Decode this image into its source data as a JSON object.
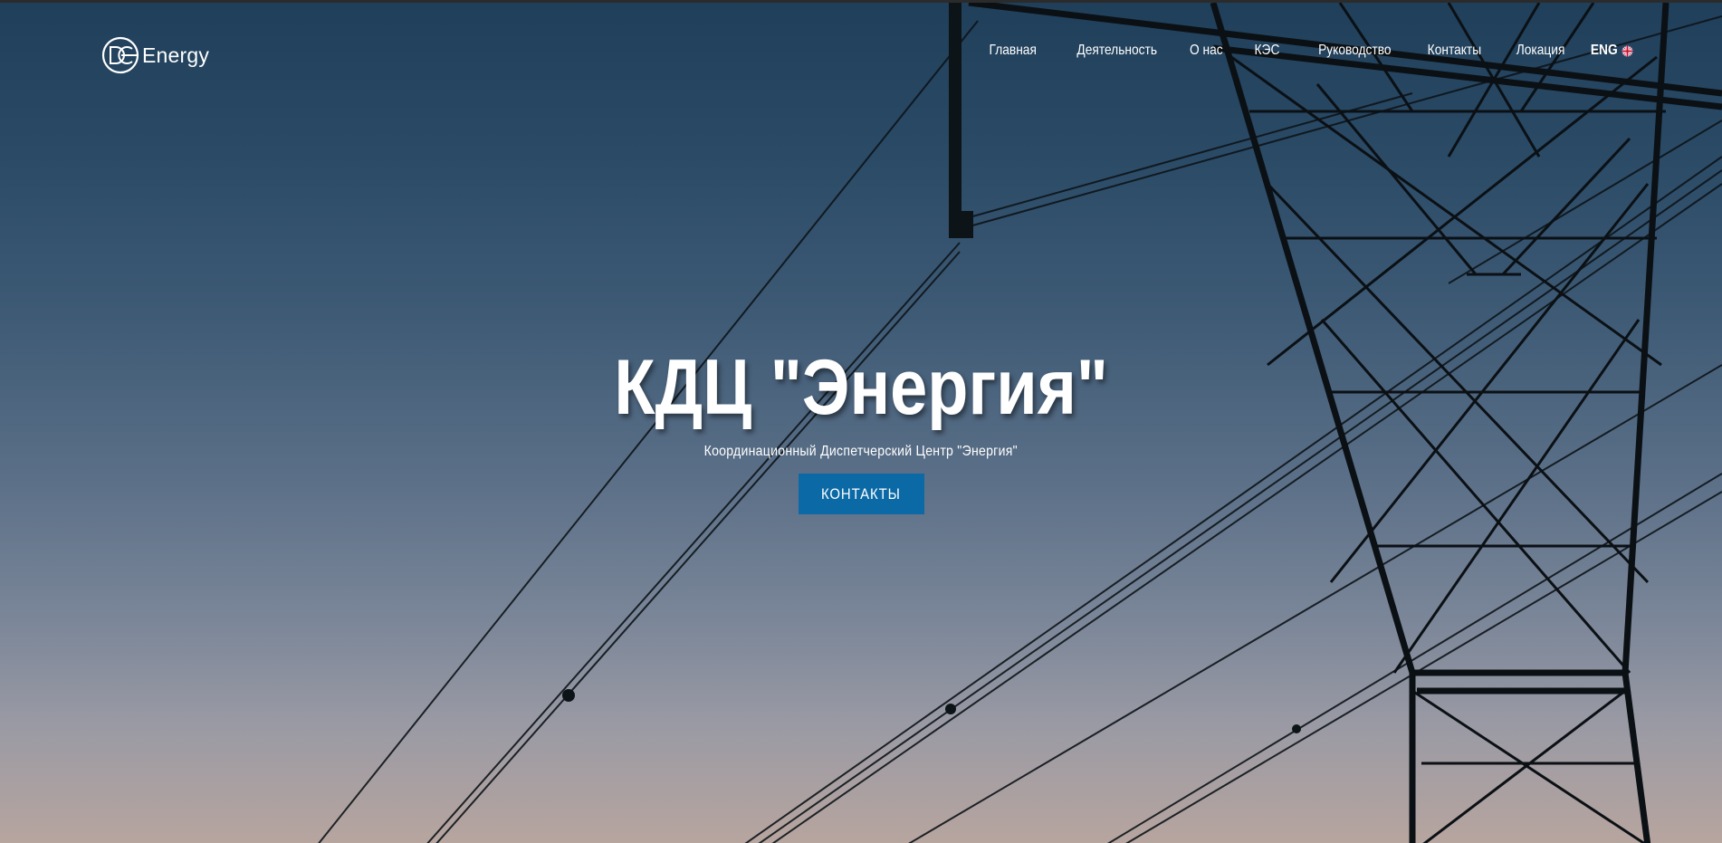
{
  "brand": {
    "logo_text": "Energy",
    "logo_icon": "dc-ring-logo-icon"
  },
  "nav": {
    "items": [
      {
        "label": "Главная"
      },
      {
        "label": "Деятельность"
      },
      {
        "label": "О нас"
      },
      {
        "label": "КЭС"
      },
      {
        "label": "Руководство"
      },
      {
        "label": "Контакты"
      },
      {
        "label": "Локация"
      }
    ],
    "language": {
      "label": "ENG",
      "icon": "uk-flag-icon"
    }
  },
  "hero": {
    "title": "КДЦ \"Энергия\"",
    "subtitle": "Координационный Диспетчерский Центр \"Энергия\"",
    "button_label": "КОНТАКТЫ"
  },
  "colors": {
    "accent": "#0b6aa6",
    "sky_top": "#1f3f5a",
    "sky_bottom": "#b7a59f",
    "text": "#ffffff"
  }
}
